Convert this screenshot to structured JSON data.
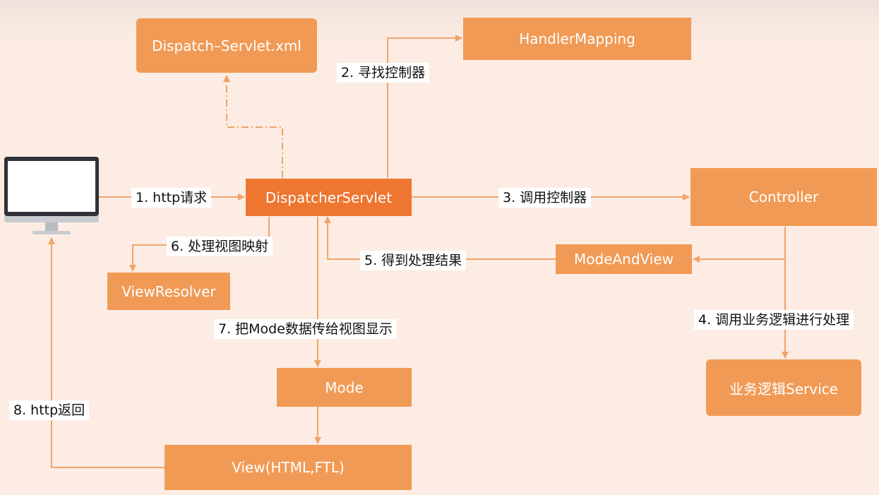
{
  "nodes": {
    "dispatch_xml": "Dispatch–Servlet.xml",
    "handler_mapping": "HandlerMapping",
    "dispatcher_servlet": "DispatcherServlet",
    "controller": "Controller",
    "mode_and_view": "ModeAndView",
    "view_resolver": "ViewResolver",
    "service": "业务逻辑Service",
    "mode": "Mode",
    "view": "View(HTML,FTL)"
  },
  "edges": {
    "step1": "1. http请求",
    "step2": "2. 寻找控制器",
    "step3": "3. 调用控制器",
    "step4": "4. 调用业务逻辑进行处理",
    "step5": "5. 得到处理结果",
    "step6": "6. 处理视图映射",
    "step7": "7. 把Mode数据传给视图显示",
    "step8": "8. http返回"
  },
  "colors": {
    "background": "#fcece3",
    "node": "#f19a55",
    "node_primary": "#ee7630",
    "edge": "#f0a469",
    "label_bg": "#ffffff"
  },
  "icons": {
    "client": "desktop-monitor-icon"
  }
}
